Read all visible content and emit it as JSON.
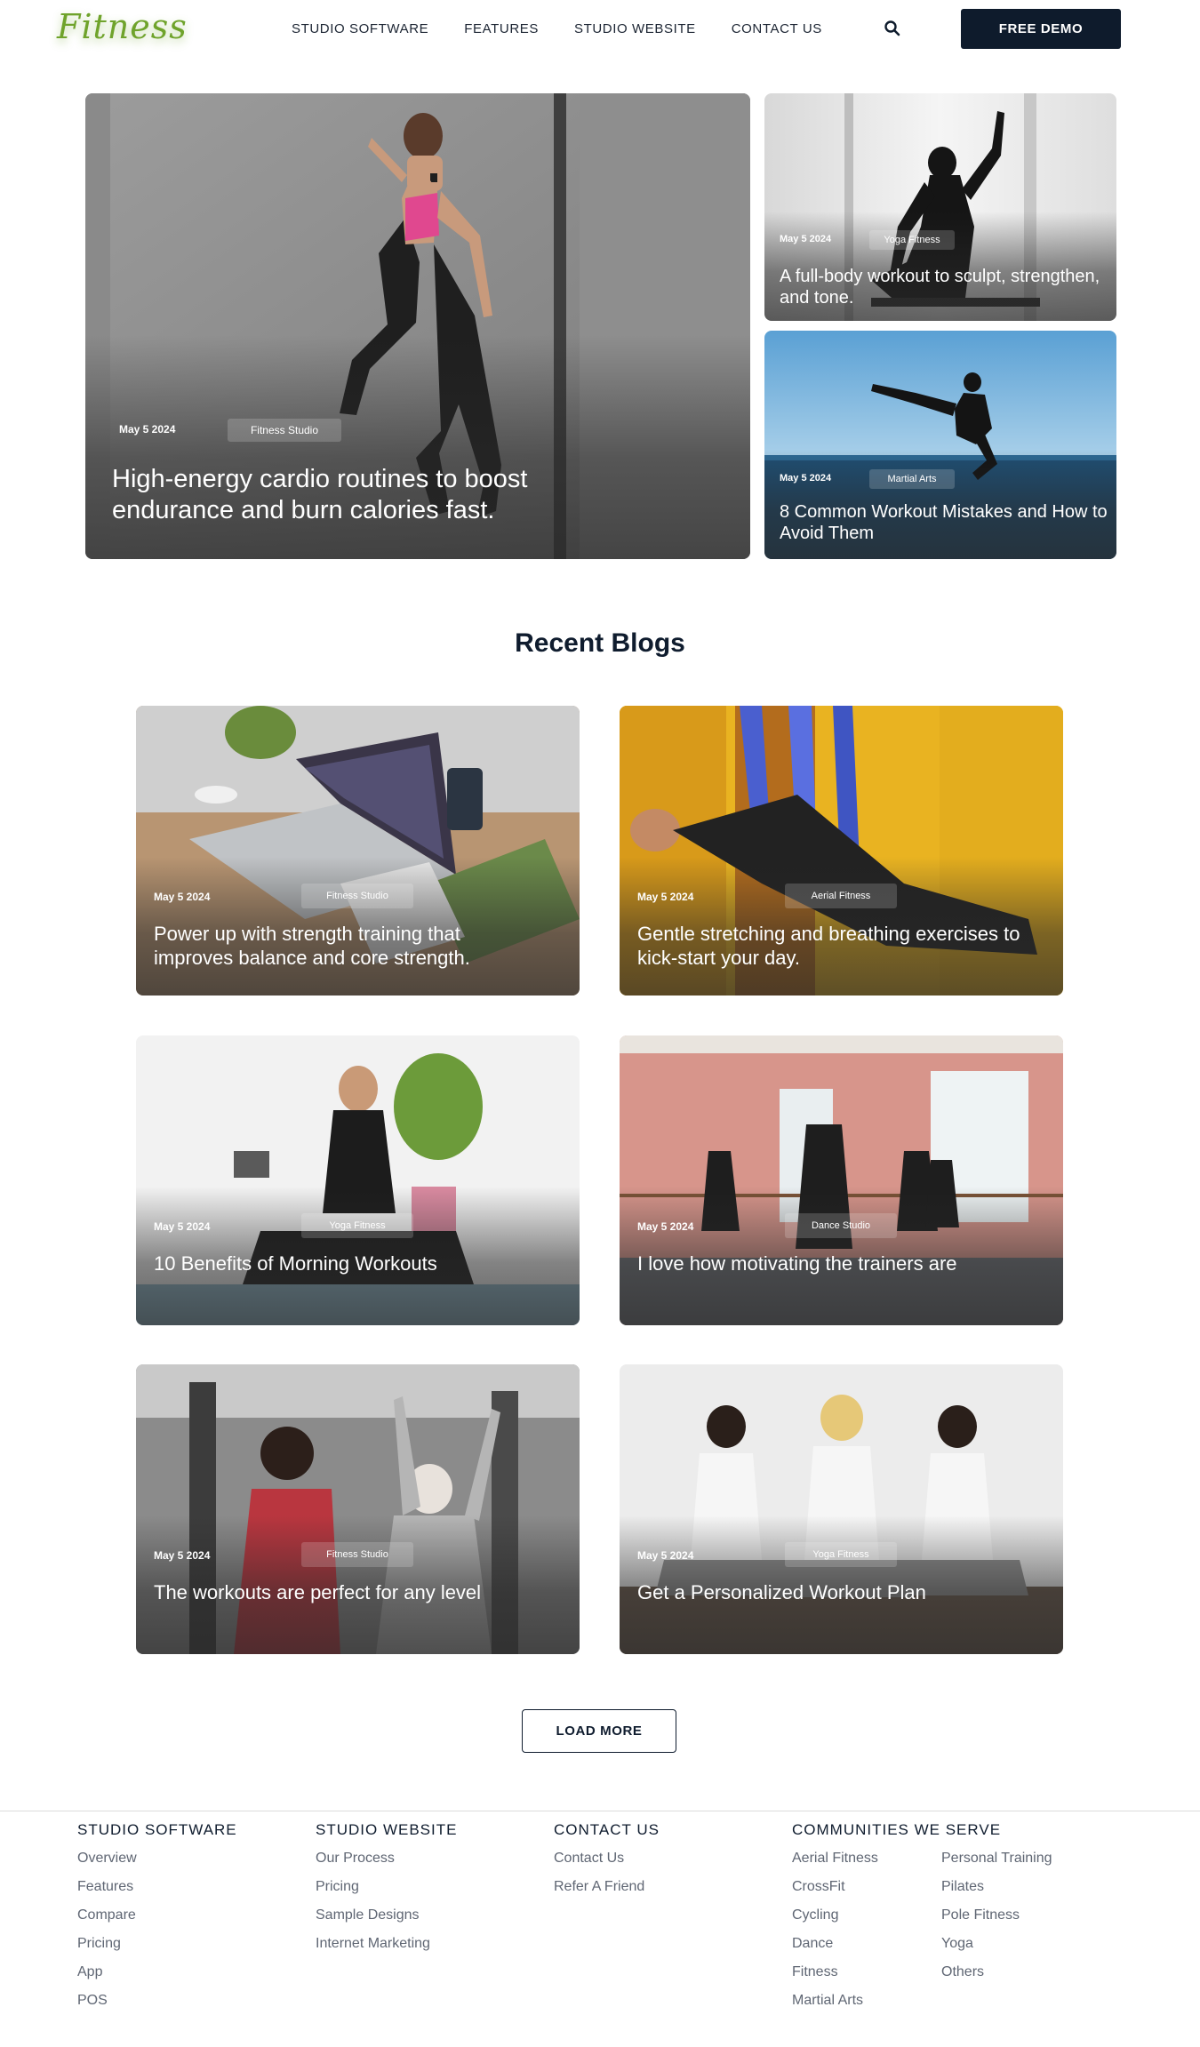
{
  "brand": {
    "logo": "Fitness",
    "accent": "#6fa32b",
    "dark": "#0e1b2c"
  },
  "nav": {
    "links": [
      "STUDIO SOFTWARE",
      "FEATURES",
      "STUDIO WEBSITE",
      "CONTACT US"
    ],
    "search_icon": "search-icon",
    "cta": "FREE DEMO"
  },
  "hero": {
    "main": {
      "date": "May 5 2024",
      "tag": "Fitness Studio",
      "title": "High-energy cardio routines to boost endurance and burn calories fast."
    },
    "side": [
      {
        "date": "May 5 2024",
        "tag": "Yoga Fitness",
        "title": "A full-body workout to sculpt, strengthen, and tone."
      },
      {
        "date": "May 5 2024",
        "tag": "Martial Arts",
        "title": "8 Common Workout Mistakes and How to Avoid Them"
      }
    ]
  },
  "recent": {
    "title": "Recent Blogs",
    "posts": [
      {
        "date": "May 5 2024",
        "tag": "Fitness Studio",
        "title": "Power up with strength training that improves balance and core strength."
      },
      {
        "date": "May 5 2024",
        "tag": "Aerial Fitness",
        "title": "Gentle stretching and breathing exercises to kick-start your day."
      },
      {
        "date": "May 5 2024",
        "tag": "Yoga Fitness",
        "title": "10 Benefits of Morning Workouts"
      },
      {
        "date": "May 5 2024",
        "tag": "Dance Studio",
        "title": "I love how motivating the trainers are"
      },
      {
        "date": "May 5 2024",
        "tag": "Fitness Studio",
        "title": "The workouts are perfect for any level"
      },
      {
        "date": "May 5 2024",
        "tag": "Yoga Fitness",
        "title": "Get a Personalized Workout Plan"
      }
    ],
    "load_more": "LOAD MORE"
  },
  "footer": {
    "studio_software": {
      "heading": "STUDIO SOFTWARE",
      "links": [
        "Overview",
        "Features",
        "Compare",
        "Pricing",
        "App",
        "POS"
      ]
    },
    "studio_website": {
      "heading": "STUDIO WEBSITE",
      "links": [
        "Our Process",
        "Pricing",
        "Sample Designs",
        "Internet Marketing"
      ]
    },
    "contact_us": {
      "heading": "CONTACT US",
      "links": [
        "Contact Us",
        "Refer A Friend"
      ]
    },
    "communities": {
      "heading": "COMMUNITIES WE SERVE",
      "col1": [
        "Aerial Fitness",
        "CrossFit",
        "Cycling",
        "Dance",
        "Fitness",
        "Martial Arts"
      ],
      "col2": [
        "Personal Training",
        "Pilates",
        "Pole Fitness",
        "Yoga",
        "Others"
      ]
    }
  }
}
